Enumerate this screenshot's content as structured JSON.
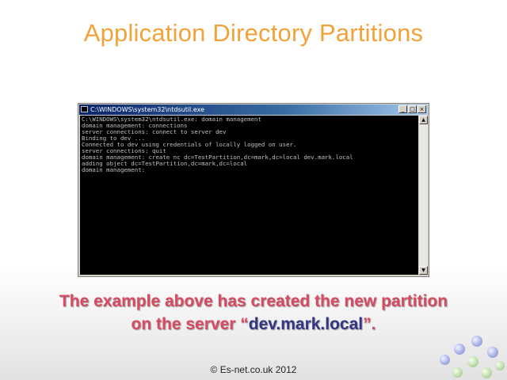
{
  "slide": {
    "title": "Application Directory Partitions",
    "caption_line1": "The example above has created the new partition",
    "caption_line2_prefix": "on the server “",
    "caption_line2_highlight": "dev.mark.local",
    "caption_line2_suffix": "”.",
    "footer": "© Es-net.co.uk 2012"
  },
  "console": {
    "title": "C:\\WINDOWS\\system32\\ntdsutil.exe",
    "minimize_glyph": "_",
    "maximize_glyph": "□",
    "close_glyph": "×",
    "scroll_up_glyph": "▲",
    "scroll_down_glyph": "▼",
    "output": "C:\\WINDOWS\\system32\\ntdsutil.exe: domain management\ndomain management: connections\nserver connections: connect to server dev\nBinding to dev ...\nConnected to dev using credentials of locally logged on user.\nserver connections: quit\ndomain management: create nc dc=TestPartition,dc=mark,dc=local dev.mark.local\nadding object dc=TestPartition,dc=mark,dc=local\ndomain management:"
  },
  "colors": {
    "title": "#f3a23a",
    "caption": "#d94a62",
    "highlight": "#353585",
    "console_bg": "#000000",
    "console_text": "#c0c0c0",
    "titlebar": "#0a246a"
  },
  "icons": [
    "console-app-icon",
    "minimize-icon",
    "maximize-icon",
    "close-icon",
    "scroll-up-icon",
    "scroll-down-icon"
  ]
}
